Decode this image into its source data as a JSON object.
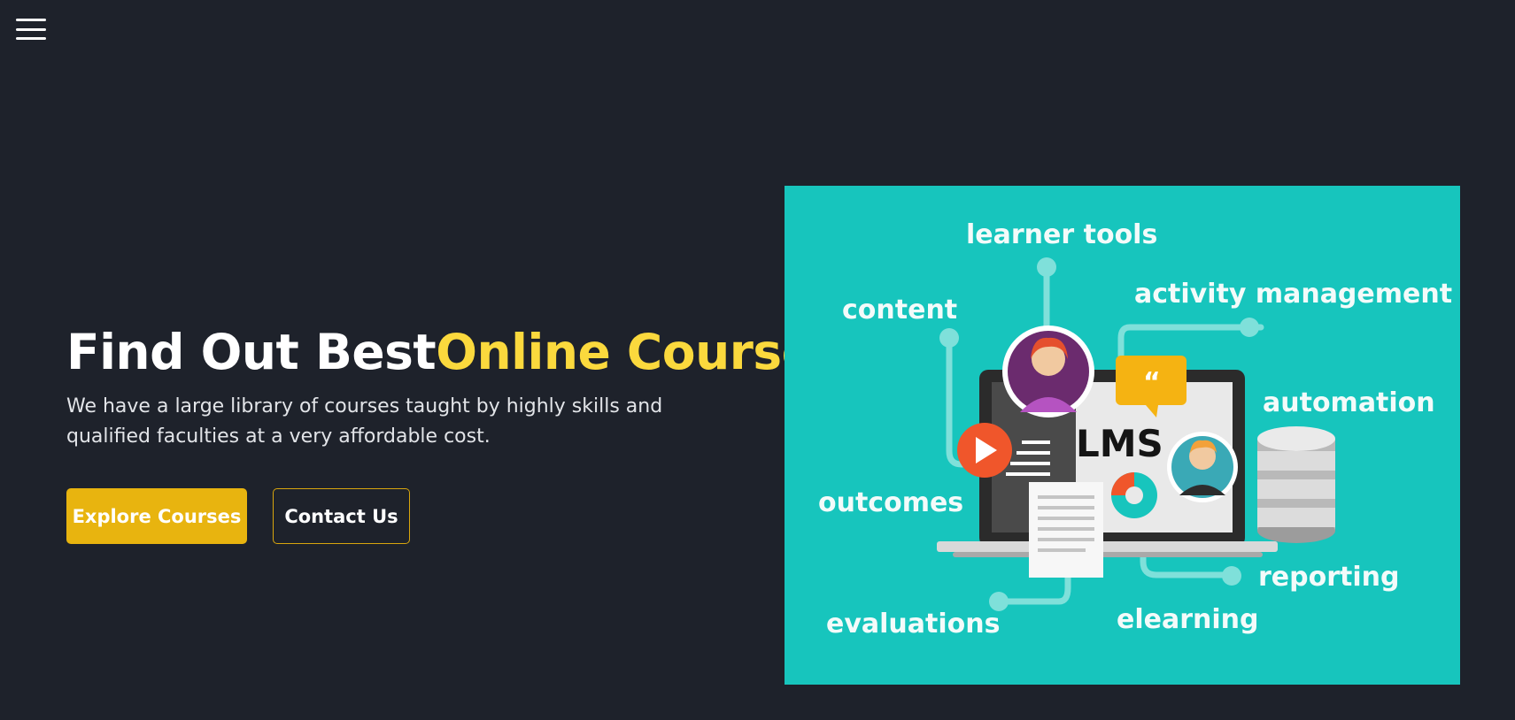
{
  "header": {
    "menu_icon": "hamburger-icon"
  },
  "hero": {
    "title_prefix": "Find Out Best",
    "title_accent": "Online Courses",
    "subtitle": "We have a large library of courses taught by highly skills and qualified faculties at a very affordable cost.",
    "accent_color": "#fbd93d"
  },
  "buttons": {
    "explore_label": "Explore Courses",
    "contact_label": "Contact Us",
    "primary_color": "#e8b40f"
  },
  "illustration": {
    "background_color": "#17c5bd",
    "labels": {
      "learner_tools": "learner tools",
      "content": "content",
      "activity_management": "activity management",
      "automation": "automation",
      "outcomes": "outcomes",
      "reporting": "reporting",
      "evaluations": "evaluations",
      "elearning": "elearning",
      "lms": "LMS"
    }
  }
}
